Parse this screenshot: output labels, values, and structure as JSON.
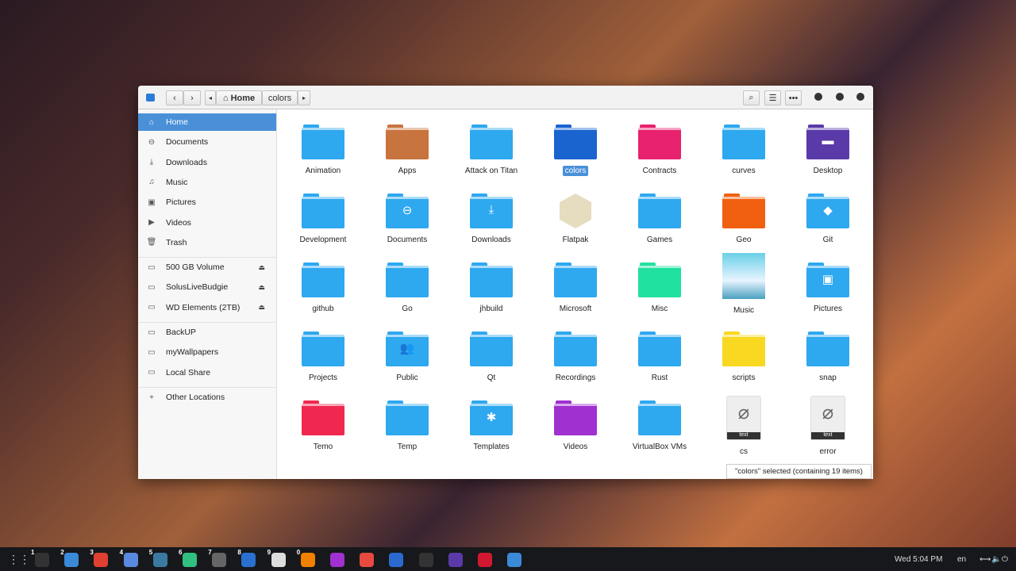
{
  "header": {
    "breadcrumb": [
      {
        "label": "Home",
        "icon": "home-icon"
      },
      {
        "label": "colors"
      }
    ]
  },
  "sidebar": {
    "places": [
      {
        "label": "Home",
        "icon": "⌂",
        "name": "home"
      },
      {
        "label": "Documents",
        "icon": "⊖",
        "name": "documents"
      },
      {
        "label": "Downloads",
        "icon": "⤓",
        "name": "downloads"
      },
      {
        "label": "Music",
        "icon": "♫",
        "name": "music"
      },
      {
        "label": "Pictures",
        "icon": "▣",
        "name": "pictures"
      },
      {
        "label": "Videos",
        "icon": "▶",
        "name": "videos"
      },
      {
        "label": "Trash",
        "icon": "🗑",
        "name": "trash"
      }
    ],
    "devices": [
      {
        "label": "500 GB Volume"
      },
      {
        "label": "SolusLiveBudgie"
      },
      {
        "label": "WD Elements (2TB)"
      }
    ],
    "bookmarks": [
      {
        "label": "BackUP"
      },
      {
        "label": "myWallpapers"
      },
      {
        "label": "Local Share"
      }
    ],
    "other": "Other Locations"
  },
  "files": [
    {
      "name": "Animation",
      "color": "#2ea8ef"
    },
    {
      "name": "Apps",
      "color": "#c8743e"
    },
    {
      "name": "Attack on Titan",
      "color": "#2ea8ef"
    },
    {
      "name": "colors",
      "color": "#1a64d0",
      "selected": true
    },
    {
      "name": "Contracts",
      "color": "#e8226e"
    },
    {
      "name": "curves",
      "color": "#2ea8ef"
    },
    {
      "name": "Desktop",
      "color": "#5a3aa8",
      "sym": "▬"
    },
    {
      "name": "Development",
      "color": "#2ea8ef"
    },
    {
      "name": "Documents",
      "color": "#2ea8ef",
      "sym": "⊖"
    },
    {
      "name": "Downloads",
      "color": "#2ea8ef",
      "sym": "⤓"
    },
    {
      "name": "Flatpak",
      "color": "#e6dcc0",
      "type": "box"
    },
    {
      "name": "Games",
      "color": "#2ea8ef"
    },
    {
      "name": "Geo",
      "color": "#f06010"
    },
    {
      "name": "Git",
      "color": "#2ea8ef",
      "sym": "◆"
    },
    {
      "name": "github",
      "color": "#2ea8ef"
    },
    {
      "name": "Go",
      "color": "#2ea8ef"
    },
    {
      "name": "jhbuild",
      "color": "#2ea8ef"
    },
    {
      "name": "Microsoft",
      "color": "#2ea8ef"
    },
    {
      "name": "Misc",
      "color": "#20e0a0"
    },
    {
      "name": "Music",
      "color": "#4ab8d8",
      "type": "image"
    },
    {
      "name": "Pictures",
      "color": "#2ea8ef",
      "sym": "▣"
    },
    {
      "name": "Projects",
      "color": "#2ea8ef"
    },
    {
      "name": "Public",
      "color": "#2ea8ef",
      "sym": "👥"
    },
    {
      "name": "Qt",
      "color": "#2ea8ef"
    },
    {
      "name": "Recordings",
      "color": "#2ea8ef"
    },
    {
      "name": "Rust",
      "color": "#2ea8ef"
    },
    {
      "name": "scripts",
      "color": "#f8d820"
    },
    {
      "name": "snap",
      "color": "#2ea8ef"
    },
    {
      "name": "Temo",
      "color": "#f02850"
    },
    {
      "name": "Temp",
      "color": "#2ea8ef"
    },
    {
      "name": "Templates",
      "color": "#2ea8ef",
      "sym": "✱"
    },
    {
      "name": "Videos",
      "color": "#a030d0"
    },
    {
      "name": "VirtualBox VMs",
      "color": "#2ea8ef"
    },
    {
      "name": "cs",
      "type": "text",
      "tag": "text"
    },
    {
      "name": "error",
      "type": "text",
      "tag": "text"
    }
  ],
  "status": "\"colors\" selected (containing 19 items)",
  "taskbar": {
    "apps": [
      {
        "n": "1",
        "c": "#333"
      },
      {
        "n": "2",
        "c": "#3a8ad8"
      },
      {
        "n": "3",
        "c": "#e04030"
      },
      {
        "n": "4",
        "c": "#5a8ae0"
      },
      {
        "n": "5",
        "c": "#3a7aa0"
      },
      {
        "n": "6",
        "c": "#30c080"
      },
      {
        "n": "7",
        "c": "#666"
      },
      {
        "n": "8",
        "c": "#2a70d0"
      },
      {
        "n": "9",
        "c": "#ddd"
      },
      {
        "n": "0",
        "c": "#f08000"
      },
      {
        "n": "",
        "c": "#a030d0"
      },
      {
        "n": "",
        "c": "#e84a40"
      },
      {
        "n": "",
        "c": "#2a6ad0"
      },
      {
        "n": "",
        "c": "#333"
      },
      {
        "n": "",
        "c": "#5a3aa8"
      },
      {
        "n": "",
        "c": "#d01830"
      },
      {
        "n": "",
        "c": "#3a8ad8"
      }
    ],
    "clock": "Wed  5:04 PM",
    "lang": "en"
  }
}
